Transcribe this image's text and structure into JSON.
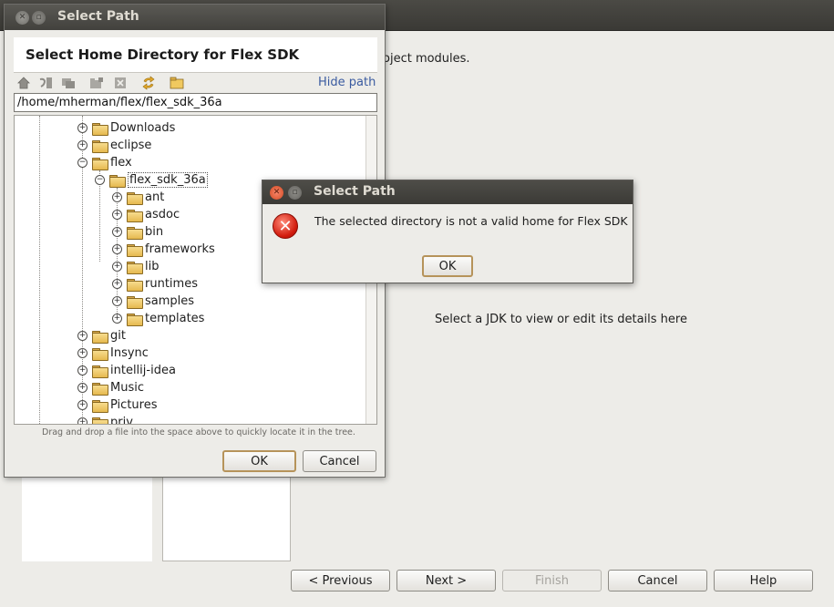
{
  "wizard": {
    "description_fragment": "oject modules.",
    "jdk_hint": "Select a JDK to view or edit its details here",
    "buttons": {
      "previous": "< Previous",
      "next": "Next >",
      "finish": "Finish",
      "cancel": "Cancel",
      "help": "Help"
    }
  },
  "chooser": {
    "window_title": "Select Path",
    "heading": "Select Home Directory for Flex SDK",
    "hide_path": "Hide path",
    "path_value": "/home/mherman/flex/flex_sdk_36a",
    "toolbar_icons": [
      "home-icon",
      "project-icon",
      "module-icon",
      "new-folder-icon",
      "delete-icon",
      "refresh-icon",
      "show-hidden-icon"
    ],
    "tree": {
      "downloads": "Downloads",
      "eclipse": "eclipse",
      "flex": "flex",
      "flex_sdk": "flex_sdk_36a",
      "ant": "ant",
      "asdoc": "asdoc",
      "bin": "bin",
      "frameworks": "frameworks",
      "lib": "lib",
      "runtimes": "runtimes",
      "samples": "samples",
      "templates": "templates",
      "git": "git",
      "insync": "Insync",
      "intellij": "intellij-idea",
      "music": "Music",
      "pictures": "Pictures",
      "priv": "priv"
    },
    "drag_hint": "Drag and drop a file into the space above to quickly locate it in the tree.",
    "ok": "OK",
    "cancel": "Cancel"
  },
  "error_dialog": {
    "title": "Select Path",
    "message": "The selected directory is not a valid home for Flex SDK",
    "ok": "OK",
    "icon": "error-icon"
  },
  "colors": {
    "titlebar": "#3c3b37",
    "error_red": "#d21c0e",
    "folder_yellow": "#e6b94f",
    "link_blue": "#3a5ba0",
    "default_button_border": "#b6935a"
  }
}
